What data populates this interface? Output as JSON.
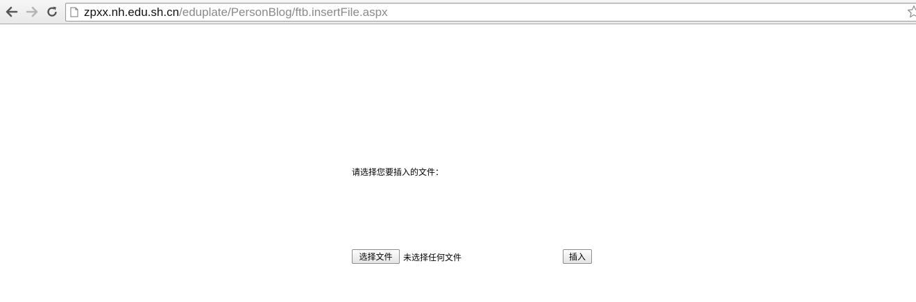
{
  "browser": {
    "url_host": "zpxx.nh.edu.sh.cn",
    "url_path": "/eduplate/PersonBlog/ftb.insertFile.aspx",
    "icons": {
      "back": "back-arrow-icon",
      "forward": "forward-arrow-icon",
      "reload": "reload-icon",
      "page": "page-icon",
      "bookmark": "star-icon"
    }
  },
  "page": {
    "prompt_text": "请选择您要插入的文件：",
    "file_input": {
      "button_label": "选择文件",
      "status_text": "未选择任何文件"
    },
    "insert_button_label": "插入"
  }
}
